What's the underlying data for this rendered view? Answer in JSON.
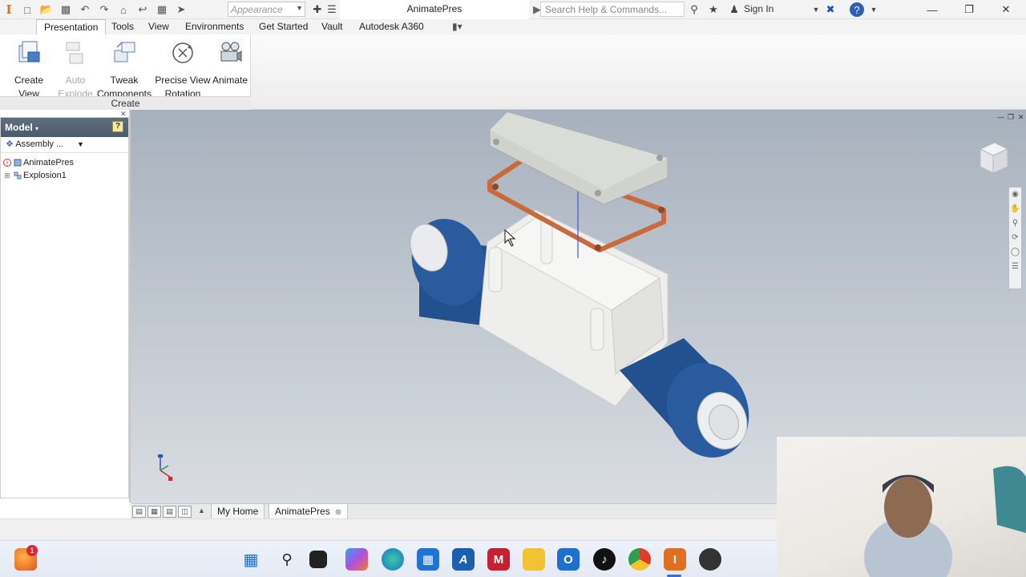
{
  "window": {
    "title": "AnimatePres",
    "appearance_placeholder": "Appearance",
    "search_placeholder": "Search Help & Commands...",
    "sign_in": "Sign In"
  },
  "tabs": [
    {
      "label": "Presentation",
      "active": true
    },
    {
      "label": "Tools"
    },
    {
      "label": "View"
    },
    {
      "label": "Environments"
    },
    {
      "label": "Get Started"
    },
    {
      "label": "Vault"
    },
    {
      "label": "Autodesk A360"
    }
  ],
  "ribbon": {
    "panel_label": "Create",
    "buttons": [
      {
        "line1": "Create View",
        "line2": "",
        "icon": "create-view-icon",
        "enabled": true
      },
      {
        "line1": "Auto",
        "line2": "Explode",
        "icon": "auto-explode-icon",
        "enabled": false
      },
      {
        "line1": "Tweak",
        "line2": "Components",
        "icon": "tweak-components-icon",
        "enabled": true
      },
      {
        "line1": "Precise View",
        "line2": "Rotation",
        "icon": "precise-view-rotation-icon",
        "enabled": true
      },
      {
        "line1": "Animate",
        "line2": "",
        "icon": "animate-icon",
        "enabled": true
      }
    ]
  },
  "browser": {
    "title": "Model",
    "help": "?",
    "assembly_selector": "Assembly ...",
    "tree": [
      {
        "label": "AnimatePres",
        "icon": "presentation-icon"
      },
      {
        "label": "Explosion1",
        "icon": "explosion-icon"
      }
    ]
  },
  "doc_tabs": {
    "home": "My Home",
    "active": "AnimatePres"
  },
  "colors": {
    "part_blue": "#23508f",
    "gasket_orange": "#c9693c",
    "housing_white": "#eeeeec",
    "cover_gray": "#cfd2cd",
    "brand_orange": "#e07020"
  },
  "taskbar": {
    "notification_count": "1",
    "icons": [
      "firefox-icon",
      "windows-start-icon",
      "search-icon",
      "terminal-icon",
      "copilot-icon",
      "edge-icon",
      "store-icon",
      "autocad-icon",
      "mcafee-icon",
      "file-explorer-icon",
      "outlook-icon",
      "tiktok-icon",
      "chrome-icon",
      "inventor-icon",
      "davinci-icon"
    ]
  }
}
